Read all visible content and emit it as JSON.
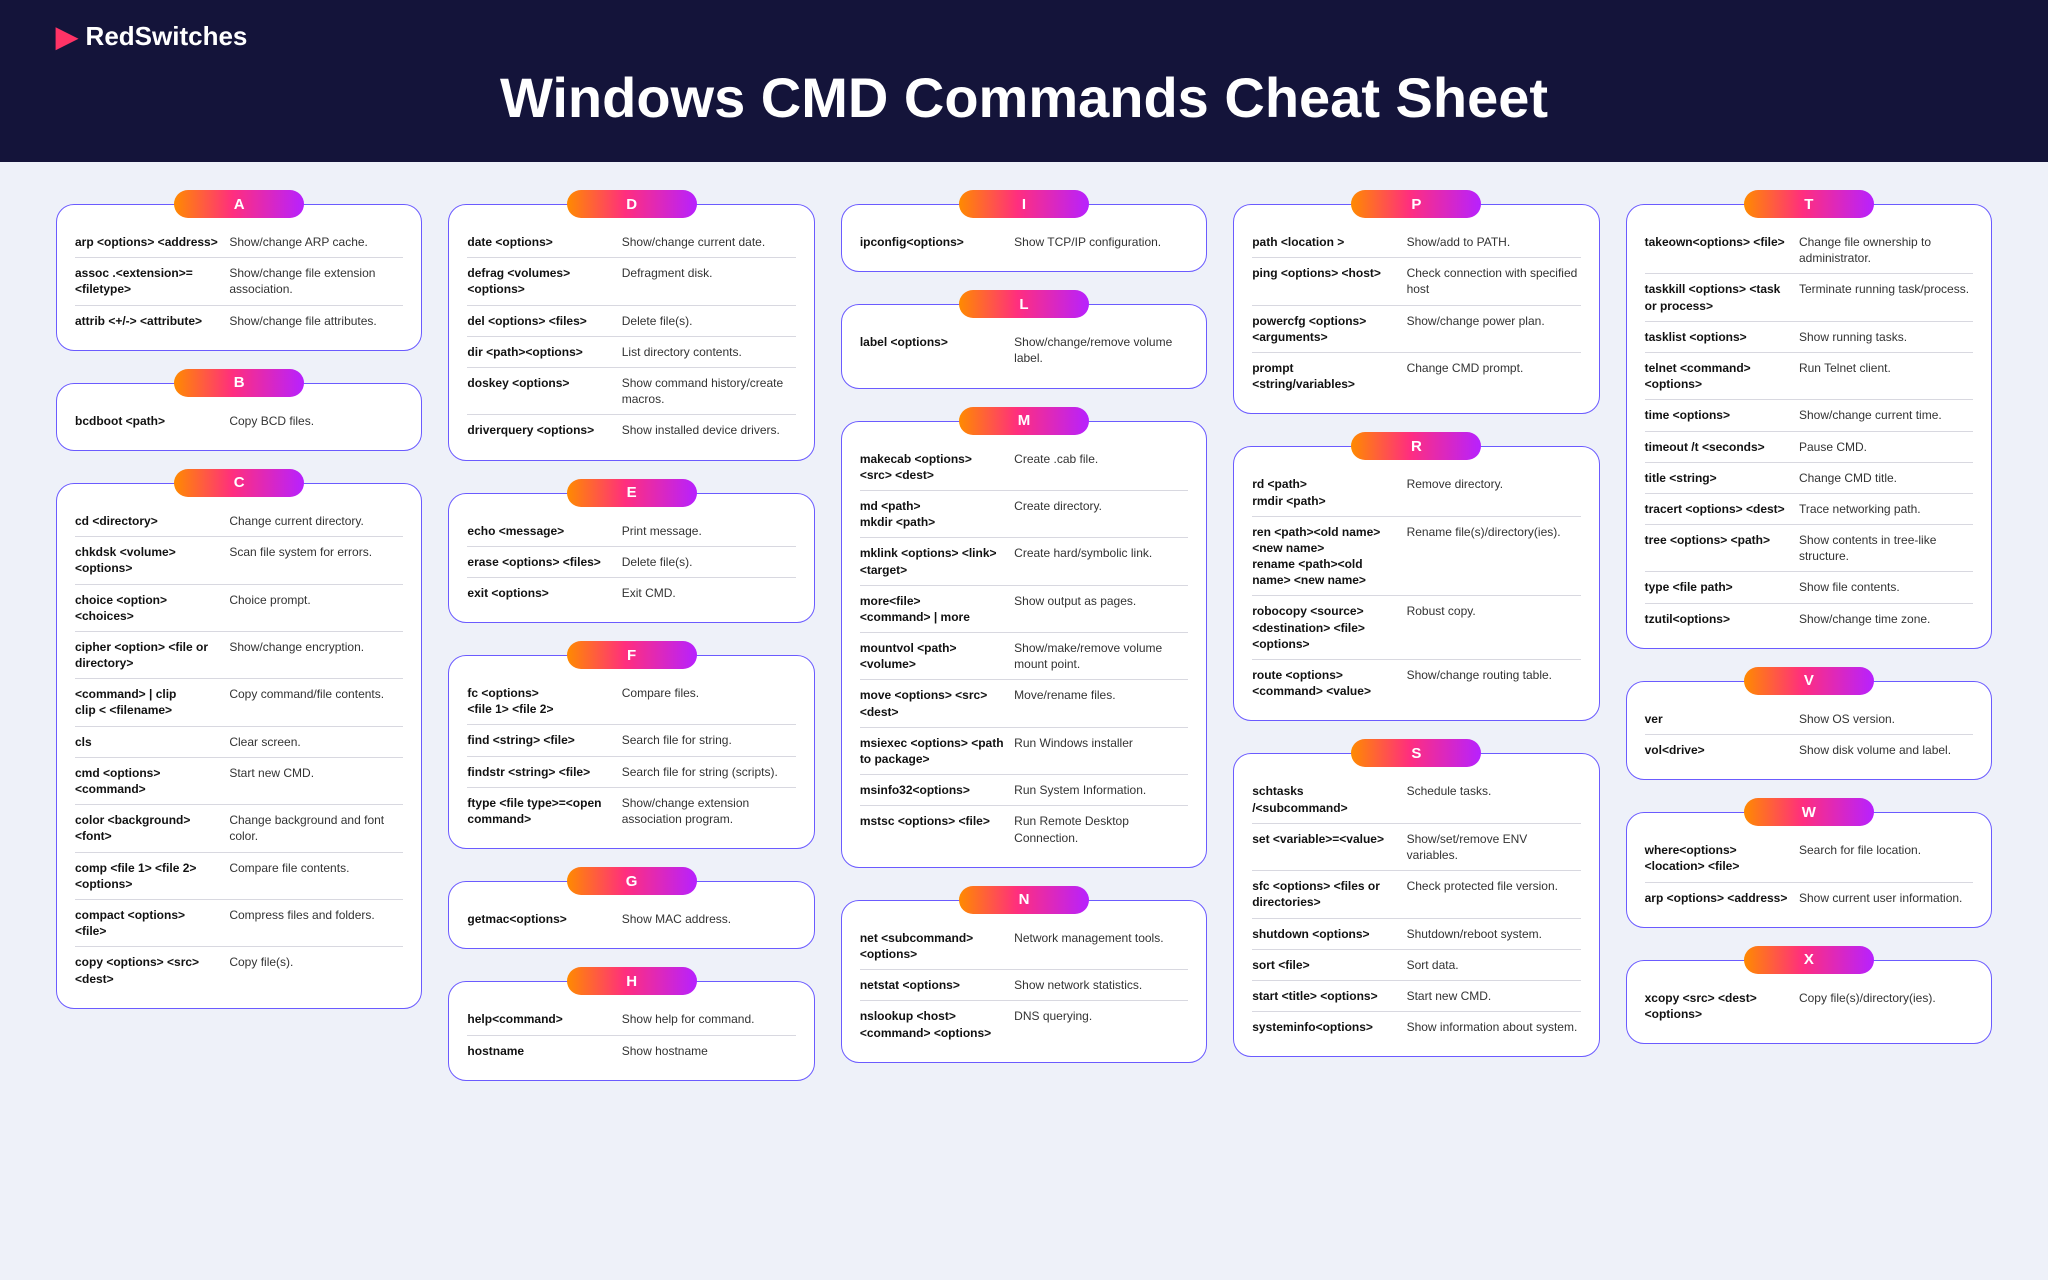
{
  "brand": "RedSwitches",
  "title": "Windows CMD Commands Cheat Sheet",
  "columns": [
    [
      {
        "letter": "A",
        "rows": [
          {
            "cmd": "arp <options> <address>",
            "desc": "Show/change ARP cache."
          },
          {
            "cmd": "assoc .<extension>=<filetype>",
            "desc": "Show/change file extension association."
          },
          {
            "cmd": "attrib <+/-> <attribute>",
            "desc": "Show/change file attributes."
          }
        ]
      },
      {
        "letter": "B",
        "rows": [
          {
            "cmd": "bcdboot <path>",
            "desc": "Copy BCD files."
          }
        ]
      },
      {
        "letter": "C",
        "rows": [
          {
            "cmd": "cd <directory>",
            "desc": "Change current directory."
          },
          {
            "cmd": "chkdsk <volume> <options>",
            "desc": "Scan file system for errors."
          },
          {
            "cmd": "choice <option> <choices>",
            "desc": "Choice prompt."
          },
          {
            "cmd": "cipher <option> <file or directory>",
            "desc": "Show/change encryption."
          },
          {
            "cmd": "<command> | clip\nclip < <filename>",
            "desc": "Copy command/file contents."
          },
          {
            "cmd": "cls",
            "desc": "Clear screen."
          },
          {
            "cmd": "cmd <options> <command>",
            "desc": "Start new CMD."
          },
          {
            "cmd": "color <background><font>",
            "desc": "Change background and font color."
          },
          {
            "cmd": "comp <file 1> <file 2> <options>",
            "desc": "Compare file contents."
          },
          {
            "cmd": "compact <options> <file>",
            "desc": "Compress files and folders."
          },
          {
            "cmd": "copy <options> <src> <dest>",
            "desc": "Copy file(s)."
          }
        ]
      }
    ],
    [
      {
        "letter": "D",
        "rows": [
          {
            "cmd": "date <options>",
            "desc": "Show/change current date."
          },
          {
            "cmd": "defrag <volumes> <options>",
            "desc": "Defragment disk."
          },
          {
            "cmd": "del <options> <files>",
            "desc": "Delete file(s)."
          },
          {
            "cmd": "dir <path><options>",
            "desc": "List directory contents."
          },
          {
            "cmd": "doskey <options>",
            "desc": "Show command history/create macros."
          },
          {
            "cmd": "driverquery <options>",
            "desc": "Show installed device drivers."
          }
        ]
      },
      {
        "letter": "E",
        "rows": [
          {
            "cmd": "echo <message>",
            "desc": "Print message."
          },
          {
            "cmd": "erase <options> <files>",
            "desc": "Delete file(s)."
          },
          {
            "cmd": "exit <options>",
            "desc": "Exit CMD."
          }
        ]
      },
      {
        "letter": "F",
        "rows": [
          {
            "cmd": "fc <options>\n<file 1> <file 2>",
            "desc": "Compare files."
          },
          {
            "cmd": "find <string> <file>",
            "desc": "Search file for string."
          },
          {
            "cmd": "findstr <string> <file>",
            "desc": "Search file for string (scripts)."
          },
          {
            "cmd": "ftype <file type>=<open command>",
            "desc": "Show/change extension association program."
          }
        ]
      },
      {
        "letter": "G",
        "rows": [
          {
            "cmd": "getmac<options>",
            "desc": "Show MAC address."
          }
        ]
      },
      {
        "letter": "H",
        "rows": [
          {
            "cmd": "help<command>",
            "desc": "Show help for command."
          },
          {
            "cmd": "hostname",
            "desc": "Show hostname"
          }
        ]
      }
    ],
    [
      {
        "letter": "I",
        "rows": [
          {
            "cmd": "ipconfig<options>",
            "desc": "Show TCP/IP configuration."
          }
        ]
      },
      {
        "letter": "L",
        "rows": [
          {
            "cmd": "label <options>",
            "desc": "Show/change/remove volume label."
          }
        ]
      },
      {
        "letter": "M",
        "rows": [
          {
            "cmd": "makecab <options> <src> <dest>",
            "desc": "Create .cab file."
          },
          {
            "cmd": "md <path>\nmkdir <path>",
            "desc": "Create directory."
          },
          {
            "cmd": "mklink <options> <link> <target>",
            "desc": "Create hard/symbolic link."
          },
          {
            "cmd": "more<file>\n<command> | more",
            "desc": "Show output as pages."
          },
          {
            "cmd": "mountvol <path> <volume>",
            "desc": "Show/make/remove volume mount point."
          },
          {
            "cmd": "move <options> <src> <dest>",
            "desc": "Move/rename files."
          },
          {
            "cmd": "msiexec <options> <path to package>",
            "desc": "Run Windows installer"
          },
          {
            "cmd": "msinfo32<options>",
            "desc": "Run System Information."
          },
          {
            "cmd": "mstsc <options> <file>",
            "desc": "Run Remote Desktop Connection."
          }
        ]
      },
      {
        "letter": "N",
        "rows": [
          {
            "cmd": "net <subcommand> <options>",
            "desc": "Network management tools."
          },
          {
            "cmd": "netstat <options>",
            "desc": "Show network statistics."
          },
          {
            "cmd": "nslookup <host> <command> <options>",
            "desc": "DNS querying."
          }
        ]
      }
    ],
    [
      {
        "letter": "P",
        "rows": [
          {
            "cmd": "path <location >",
            "desc": "Show/add to PATH."
          },
          {
            "cmd": "ping <options> <host>",
            "desc": "Check connection with specified host"
          },
          {
            "cmd": "powercfg <options> <arguments>",
            "desc": "Show/change power plan."
          },
          {
            "cmd": "prompt <string/variables>",
            "desc": "Change CMD prompt."
          }
        ]
      },
      {
        "letter": "R",
        "rows": [
          {
            "cmd": "rd <path>\nrmdir <path>",
            "desc": "Remove directory."
          },
          {
            "cmd": "ren <path><old name> <new name>\nrename <path><old name> <new name>",
            "desc": "Rename file(s)/directory(ies)."
          },
          {
            "cmd": "robocopy <source> <destination> <file> <options>",
            "desc": "Robust copy."
          },
          {
            "cmd": "route <options> <command> <value>",
            "desc": "Show/change routing table."
          }
        ]
      },
      {
        "letter": "S",
        "rows": [
          {
            "cmd": "schtasks /<subcommand>",
            "desc": "Schedule tasks."
          },
          {
            "cmd": "set <variable>=<value>",
            "desc": "Show/set/remove ENV variables."
          },
          {
            "cmd": "sfc <options> <files or directories>",
            "desc": "Check protected file version."
          },
          {
            "cmd": "shutdown <options>",
            "desc": "Shutdown/reboot system."
          },
          {
            "cmd": "sort <file>",
            "desc": "Sort data."
          },
          {
            "cmd": "start <title> <options>",
            "desc": "Start new CMD."
          },
          {
            "cmd": "systeminfo<options>",
            "desc": "Show information about system."
          }
        ]
      }
    ],
    [
      {
        "letter": "T",
        "rows": [
          {
            "cmd": "takeown<options> <file>",
            "desc": "Change file ownership to administrator."
          },
          {
            "cmd": "taskkill <options> <task or process>",
            "desc": "Terminate running task/process."
          },
          {
            "cmd": "tasklist <options>",
            "desc": "Show running tasks."
          },
          {
            "cmd": "telnet <command> <options>",
            "desc": "Run Telnet client."
          },
          {
            "cmd": "time <options>",
            "desc": "Show/change current time."
          },
          {
            "cmd": "timeout /t <seconds>",
            "desc": "Pause CMD."
          },
          {
            "cmd": "title <string>",
            "desc": "Change CMD title."
          },
          {
            "cmd": "tracert <options> <dest>",
            "desc": "Trace networking path."
          },
          {
            "cmd": "tree <options> <path>",
            "desc": "Show contents in tree-like structure."
          },
          {
            "cmd": "type <file path>",
            "desc": "Show file contents."
          },
          {
            "cmd": "tzutil<options>",
            "desc": "Show/change time zone."
          }
        ]
      },
      {
        "letter": "V",
        "rows": [
          {
            "cmd": "ver",
            "desc": "Show OS version."
          },
          {
            "cmd": "vol<drive>",
            "desc": "Show disk volume and label."
          }
        ]
      },
      {
        "letter": "W",
        "rows": [
          {
            "cmd": "where<options> <location> <file>",
            "desc": "Search for file location."
          },
          {
            "cmd": "arp <options> <address>",
            "desc": "Show current user information."
          }
        ]
      },
      {
        "letter": "X",
        "rows": [
          {
            "cmd": "xcopy <src> <dest> <options>",
            "desc": "Copy file(s)/directory(ies)."
          }
        ]
      }
    ]
  ]
}
